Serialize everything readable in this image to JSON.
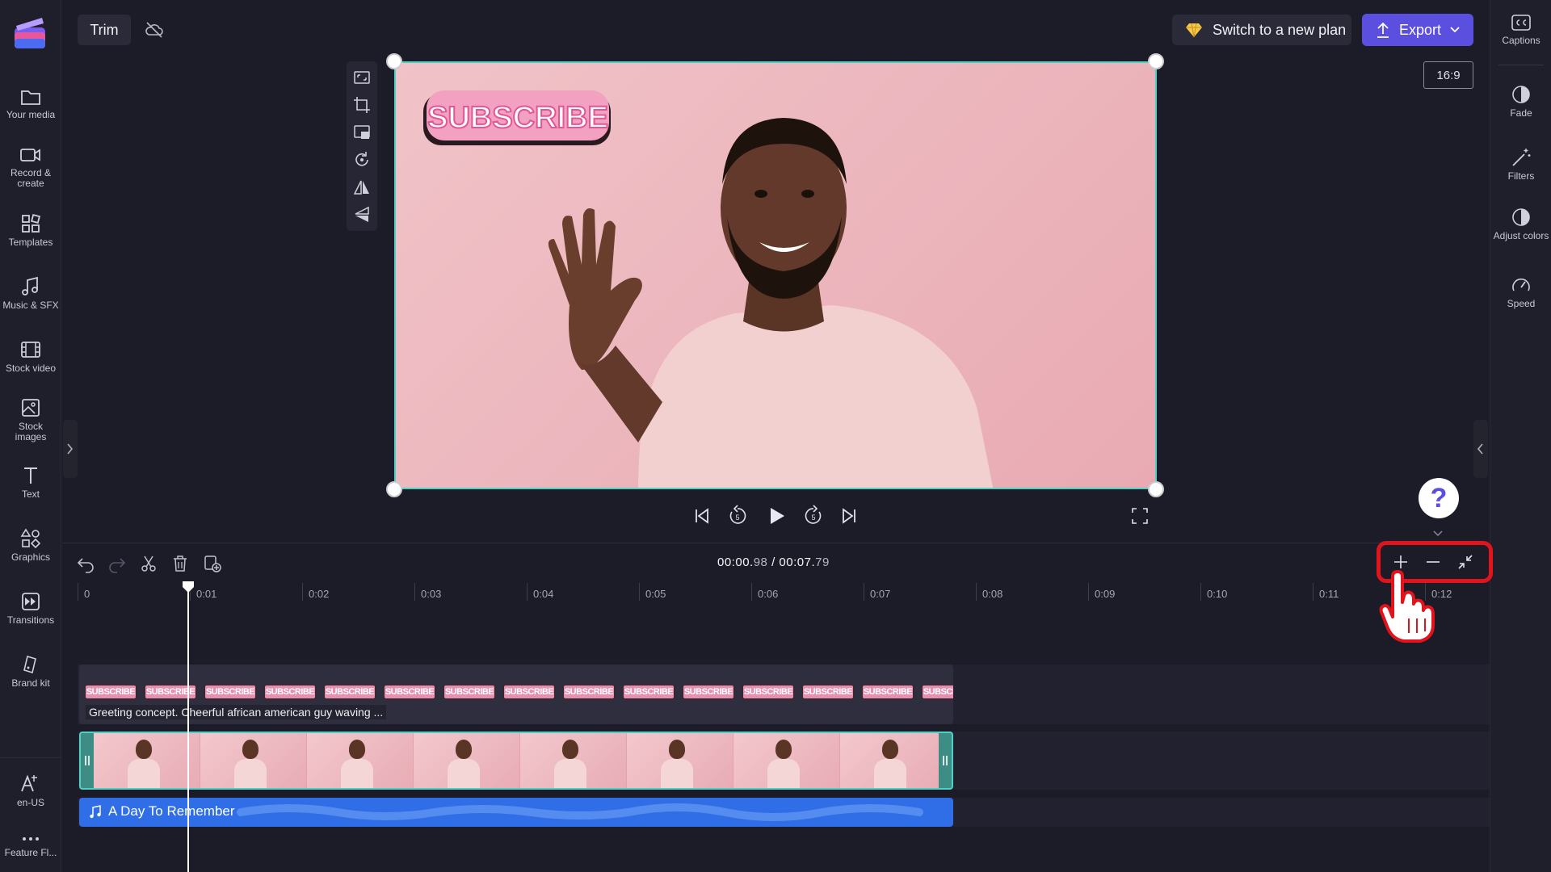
{
  "sidebar": {
    "items": [
      {
        "label": "Your media"
      },
      {
        "label": "Record & create"
      },
      {
        "label": "Templates"
      },
      {
        "label": "Music & SFX"
      },
      {
        "label": "Stock video"
      },
      {
        "label": "Stock images"
      },
      {
        "label": "Text"
      },
      {
        "label": "Graphics"
      },
      {
        "label": "Transitions"
      },
      {
        "label": "Brand kit"
      }
    ],
    "language": "en-US",
    "feature_flags": "Feature Fl..."
  },
  "toolbar": {
    "trim_label": "Trim",
    "plan_label": "Switch to a new plan",
    "export_label": "Export",
    "aspect_ratio": "16:9"
  },
  "right_panel": {
    "items": [
      {
        "label": "Captions"
      },
      {
        "label": "Fade"
      },
      {
        "label": "Filters"
      },
      {
        "label": "Adjust colors"
      },
      {
        "label": "Speed"
      }
    ]
  },
  "preview": {
    "sticker_text": "SUBSCRIBE"
  },
  "help": {
    "label": "?"
  },
  "timeline": {
    "current_time": "00:00.",
    "current_time_frac": "98",
    "separator": " / ",
    "total_time": "00:07.",
    "total_time_frac": "79",
    "ticks": [
      "0",
      "0:01",
      "0:02",
      "0:03",
      "0:04",
      "0:05",
      "0:06",
      "0:07",
      "0:08",
      "0:09",
      "0:10",
      "0:11",
      "0:12"
    ],
    "sticker_clip_name": "Greeting concept. Cheerful african american guy waving ...",
    "sticker_thumb_text": "SUBSCRIBE",
    "audio_clip_name": "A Day To Remember"
  },
  "colors": {
    "accent": "#5b4fe0",
    "selection": "#4fd1c5",
    "highlight": "#e3131b",
    "audio": "#2f6ee6"
  }
}
